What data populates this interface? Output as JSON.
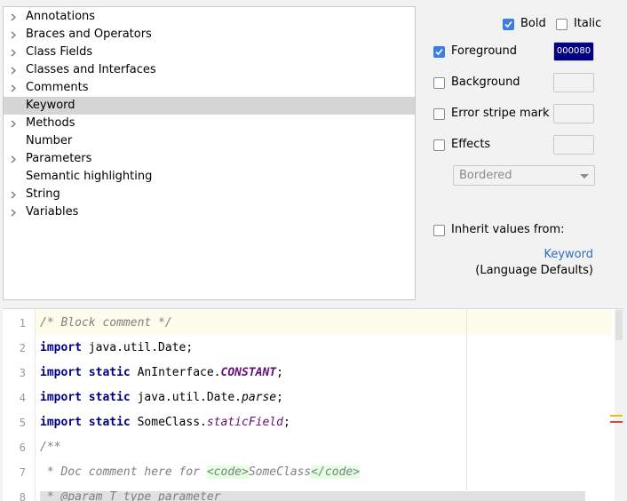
{
  "tree": {
    "items": [
      {
        "label": "Annotations",
        "expandable": true,
        "selected": false
      },
      {
        "label": "Braces and Operators",
        "expandable": true,
        "selected": false
      },
      {
        "label": "Class Fields",
        "expandable": true,
        "selected": false
      },
      {
        "label": "Classes and Interfaces",
        "expandable": true,
        "selected": false
      },
      {
        "label": "Comments",
        "expandable": true,
        "selected": false
      },
      {
        "label": "Keyword",
        "expandable": false,
        "selected": true
      },
      {
        "label": "Methods",
        "expandable": true,
        "selected": false
      },
      {
        "label": "Number",
        "expandable": false,
        "selected": false
      },
      {
        "label": "Parameters",
        "expandable": true,
        "selected": false
      },
      {
        "label": "Semantic highlighting",
        "expandable": false,
        "selected": false
      },
      {
        "label": "String",
        "expandable": true,
        "selected": false
      },
      {
        "label": "Variables",
        "expandable": true,
        "selected": false
      }
    ]
  },
  "options": {
    "bold_label": "Bold",
    "bold_checked": true,
    "italic_label": "Italic",
    "italic_checked": false,
    "foreground_label": "Foreground",
    "foreground_checked": true,
    "foreground_color": "000080",
    "background_label": "Background",
    "background_checked": false,
    "error_stripe_label": "Error stripe mark",
    "error_stripe_checked": false,
    "effects_label": "Effects",
    "effects_checked": false,
    "effect_type": "Bordered",
    "inherit_label": "Inherit values from:",
    "inherit_checked": false,
    "inherit_link": "Keyword",
    "inherit_source": "(Language Defaults)"
  },
  "preview": {
    "line_numbers": [
      "1",
      "2",
      "3",
      "4",
      "5",
      "6",
      "7",
      "8"
    ],
    "line1": "/* Block comment */",
    "l2_kw": "import",
    "l2_rest": " java.util.Date;",
    "l3_kw1": "import",
    "l3_kw2": "static",
    "l3_cls": " AnInterface.",
    "l3_const": "CONSTANT",
    "l3_end": ";",
    "l4_kw1": "import",
    "l4_kw2": "static",
    "l4_cls": " java.util.Date.",
    "l4_meth": "parse",
    "l4_end": ";",
    "l5_kw1": "import",
    "l5_kw2": "static",
    "l5_cls": " SomeClass.",
    "l5_field": "staticField",
    "l5_end": ";",
    "line6": "/**",
    "l7_pre": " * Doc comment here for ",
    "l7_tag1": "<code>",
    "l7_mid": "SomeClass",
    "l7_tag2": "</code>",
    "line8": " * @param T type parameter"
  },
  "colors": {
    "keyword": "#000080",
    "selection": "#d5d5d5",
    "accent": "#3b7de4",
    "link": "#2e6fc0"
  }
}
